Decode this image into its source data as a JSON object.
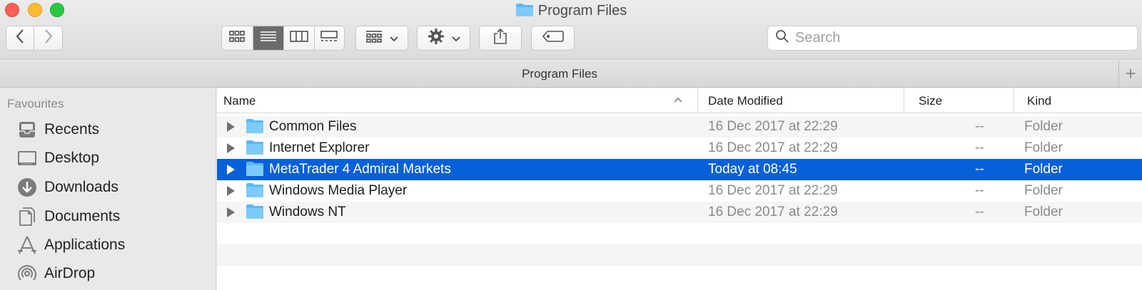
{
  "window": {
    "title": "Program Files"
  },
  "toolbar": {
    "back_icon": "chevron-left-icon",
    "forward_icon": "chevron-right-icon",
    "view_modes": [
      "icon-view",
      "list-view",
      "column-view",
      "gallery-view"
    ],
    "active_view": "list-view",
    "search_placeholder": "Search"
  },
  "pathbar": {
    "title": "Program Files",
    "add_tab_label": "+"
  },
  "sidebar": {
    "heading": "Favourites",
    "items": [
      {
        "label": "Recents",
        "icon": "recents-icon"
      },
      {
        "label": "Desktop",
        "icon": "desktop-icon"
      },
      {
        "label": "Downloads",
        "icon": "downloads-icon"
      },
      {
        "label": "Documents",
        "icon": "documents-icon"
      },
      {
        "label": "Applications",
        "icon": "applications-icon"
      },
      {
        "label": "AirDrop",
        "icon": "airdrop-icon"
      }
    ]
  },
  "list": {
    "columns": {
      "name": "Name",
      "date": "Date Modified",
      "size": "Size",
      "kind": "Kind"
    },
    "sort_indicator": "^",
    "rows": [
      {
        "name": "Common Files",
        "date": "16 Dec 2017 at 22:29",
        "size": "--",
        "kind": "Folder"
      },
      {
        "name": "Internet Explorer",
        "date": "16 Dec 2017 at 22:29",
        "size": "--",
        "kind": "Folder"
      },
      {
        "name": "MetaTrader 4 Admiral Markets",
        "date": "Today at 08:45",
        "size": "--",
        "kind": "Folder"
      },
      {
        "name": "Windows Media Player",
        "date": "16 Dec 2017 at 22:29",
        "size": "--",
        "kind": "Folder"
      },
      {
        "name": "Windows NT",
        "date": "16 Dec 2017 at 22:29",
        "size": "--",
        "kind": "Folder"
      }
    ],
    "selected_index": 2
  },
  "colors": {
    "selection": "#0860d8",
    "folder": "#5ab8f5"
  }
}
